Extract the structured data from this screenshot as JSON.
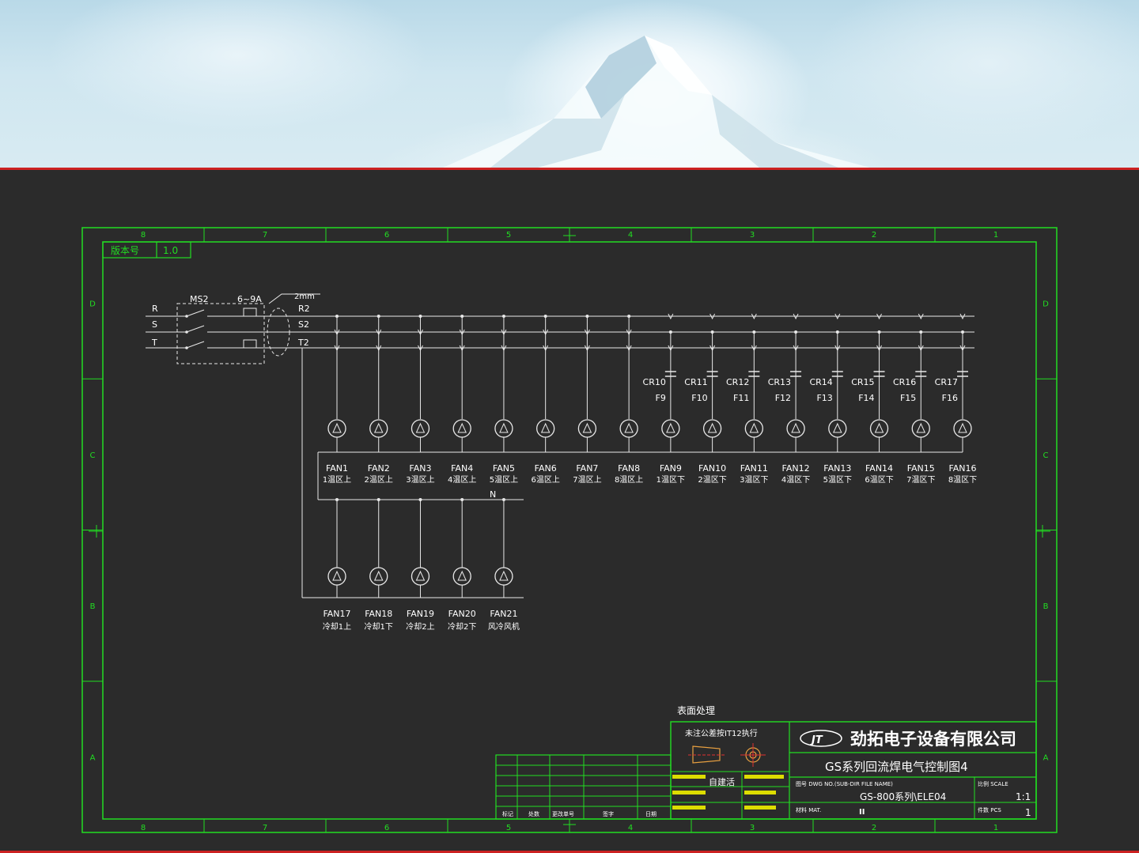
{
  "header": {
    "version_label": "版本号",
    "version_value": "1.0"
  },
  "border": {
    "columns": [
      "8",
      "7",
      "6",
      "5",
      "4",
      "3",
      "2",
      "1"
    ],
    "rows": [
      "D",
      "C",
      "B",
      "A"
    ]
  },
  "supply": {
    "phases": [
      "R",
      "S",
      "T"
    ],
    "outputs": [
      "R2",
      "S2",
      "T2"
    ],
    "breaker": "MS2",
    "breaker_rating": "6~9A",
    "wire_size": "2mm",
    "neutral": "N"
  },
  "relays": [
    {
      "name": "CR10",
      "fuse": "F9"
    },
    {
      "name": "CR11",
      "fuse": "F10"
    },
    {
      "name": "CR12",
      "fuse": "F11"
    },
    {
      "name": "CR13",
      "fuse": "F12"
    },
    {
      "name": "CR14",
      "fuse": "F13"
    },
    {
      "name": "CR15",
      "fuse": "F14"
    },
    {
      "name": "CR16",
      "fuse": "F15"
    },
    {
      "name": "CR17",
      "fuse": "F16"
    }
  ],
  "fans_top": [
    {
      "name": "FAN1",
      "desc": "1温区上"
    },
    {
      "name": "FAN2",
      "desc": "2温区上"
    },
    {
      "name": "FAN3",
      "desc": "3温区上"
    },
    {
      "name": "FAN4",
      "desc": "4温区上"
    },
    {
      "name": "FAN5",
      "desc": "5温区上"
    },
    {
      "name": "FAN6",
      "desc": "6温区上"
    },
    {
      "name": "FAN7",
      "desc": "7温区上"
    },
    {
      "name": "FAN8",
      "desc": "8温区上"
    },
    {
      "name": "FAN9",
      "desc": "1温区下"
    },
    {
      "name": "FAN10",
      "desc": "2温区下"
    },
    {
      "name": "FAN11",
      "desc": "3温区下"
    },
    {
      "name": "FAN12",
      "desc": "4温区下"
    },
    {
      "name": "FAN13",
      "desc": "5温区下"
    },
    {
      "name": "FAN14",
      "desc": "6温区下"
    },
    {
      "name": "FAN15",
      "desc": "7温区下"
    },
    {
      "name": "FAN16",
      "desc": "8温区下"
    }
  ],
  "fans_bottom": [
    {
      "name": "FAN17",
      "desc": "冷却1上"
    },
    {
      "name": "FAN18",
      "desc": "冷却1下"
    },
    {
      "name": "FAN19",
      "desc": "冷却2上"
    },
    {
      "name": "FAN20",
      "desc": "冷却2下"
    },
    {
      "name": "FAN21",
      "desc": "风冷风机"
    }
  ],
  "title_block": {
    "surface_label": "表面处理",
    "tolerance_note": "未注公差按IT12执行",
    "company": "劲拓电子设备有限公司",
    "drawing_title": "GS系列回流焊电气控制图4",
    "dwg_no_label": "图号 DWG NO.(SUB-DIR FILE NAME)",
    "dwg_no": "GS-800系列\\ELE04",
    "scale_label": "比例 SCALE",
    "scale": "1:1",
    "material_label": "材料 MAT.",
    "material": "II",
    "qty_label": "件数 PCS",
    "qty": "1",
    "approval_label": "自建活",
    "revision_headers": [
      "标记",
      "处数",
      "更改单号",
      "签字",
      "日期"
    ]
  },
  "colors": {
    "frame": "#22dd22",
    "wire": "#e8e8e8",
    "background": "#2b2b2b",
    "rule": "#cc2222"
  }
}
